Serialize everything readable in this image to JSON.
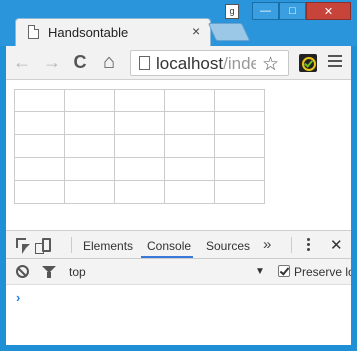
{
  "tab": {
    "title": "Handsontable",
    "close_glyph": "×"
  },
  "window_controls": {
    "user_badge": "g",
    "minimize": "—",
    "maximize": "□",
    "close": "✕"
  },
  "toolbar": {
    "back_glyph": "←",
    "forward_glyph": "→",
    "reload_glyph": "C",
    "home_glyph": "⌂",
    "url_host": "localhost",
    "url_rest": "/inde",
    "star_glyph": "☆"
  },
  "grid": {
    "rows": 5,
    "cols": 5,
    "cells": [
      [
        "",
        "",
        "",
        "",
        ""
      ],
      [
        "",
        "",
        "",
        "",
        ""
      ],
      [
        "",
        "",
        "",
        "",
        ""
      ],
      [
        "",
        "",
        "",
        "",
        ""
      ],
      [
        "",
        "",
        "",
        "",
        ""
      ]
    ]
  },
  "devtools": {
    "tabs": [
      "Elements",
      "Console",
      "Sources"
    ],
    "selected_tab": "Console",
    "more_glyph": "»",
    "close_glyph": "✕",
    "context": "top",
    "dropdown_glyph": "▼",
    "preserve_log_label": "Preserve lo",
    "preserve_log_checked": true,
    "prompt_glyph": "›",
    "accent_color": "#3879d9"
  }
}
